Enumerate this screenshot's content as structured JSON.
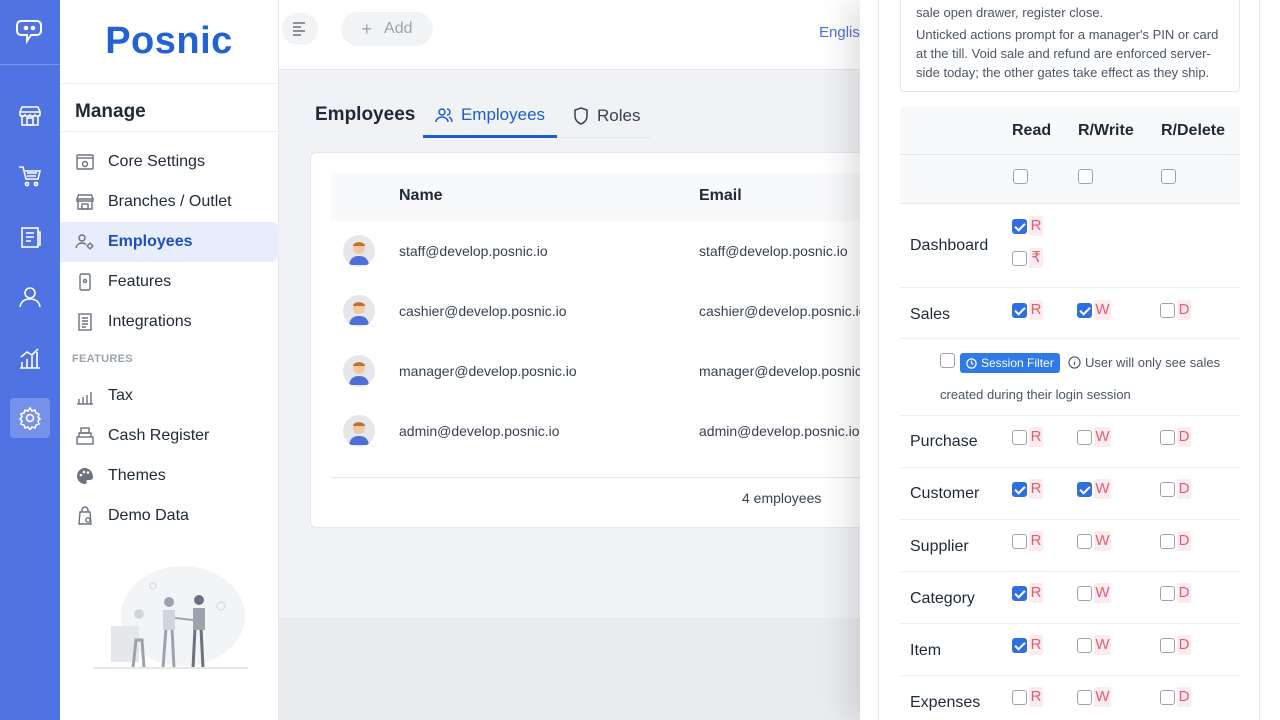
{
  "app": {
    "brand": "Posnic"
  },
  "rail": {
    "icons": [
      "logo-icon",
      "store-icon",
      "cart-icon",
      "clipboard-icon",
      "user-icon",
      "chart-icon",
      "settings-icon"
    ]
  },
  "sidebar": {
    "section_title": "Manage",
    "items": [
      {
        "label": "Core Settings",
        "icon": "settings-gear-icon"
      },
      {
        "label": "Branches / Outlet",
        "icon": "store-icon"
      },
      {
        "label": "Employees",
        "icon": "users-gear-icon",
        "active": true
      },
      {
        "label": "Features",
        "icon": "phone-icon"
      },
      {
        "label": "Integrations",
        "icon": "document-icon"
      }
    ],
    "features_header": "FEATURES",
    "feature_items": [
      {
        "label": "Tax",
        "icon": "chart-icon"
      },
      {
        "label": "Cash Register",
        "icon": "register-icon"
      },
      {
        "label": "Themes",
        "icon": "palette-icon"
      },
      {
        "label": "Demo Data",
        "icon": "data-icon"
      }
    ]
  },
  "topbar": {
    "add_label": "Add",
    "language": "English"
  },
  "main": {
    "page_title": "Employees",
    "tabs": [
      {
        "label": "Employees",
        "active": true
      },
      {
        "label": "Roles"
      }
    ],
    "table": {
      "columns": [
        "Name",
        "Email"
      ],
      "rows": [
        {
          "name": "staff@develop.posnic.io",
          "email": "staff@develop.posnic.io"
        },
        {
          "name": "cashier@develop.posnic.io",
          "email": "cashier@develop.posnic.io"
        },
        {
          "name": "manager@develop.posnic.io",
          "email": "manager@develop.posnic.io"
        },
        {
          "name": "admin@develop.posnic.io",
          "email": "admin@develop.posnic.io"
        }
      ],
      "footer": "4 employees"
    }
  },
  "drawer": {
    "info_line1": "sale open drawer, register close.",
    "info_line2": "Unticked actions prompt for a manager's PIN or card at the till. Void sale and refund are enforced server-side today; the other gates take effect as they ship.",
    "columns": [
      "Read",
      "R/Write",
      "R/Delete"
    ],
    "permissions": [
      {
        "name": "Dashboard",
        "read": true,
        "extra": false
      },
      {
        "name": "Sales",
        "read": true,
        "write": true,
        "delete": false
      },
      {
        "name": "Purchase",
        "read": false,
        "write": false,
        "delete": false
      },
      {
        "name": "Customer",
        "read": true,
        "write": true,
        "delete": false
      },
      {
        "name": "Supplier",
        "read": false,
        "write": false,
        "delete": false
      },
      {
        "name": "Category",
        "read": true,
        "write": false,
        "delete": false
      },
      {
        "name": "Item",
        "read": true,
        "write": false,
        "delete": false
      },
      {
        "name": "Expenses",
        "read": false,
        "write": false,
        "delete": false
      }
    ],
    "labels": {
      "read": "R",
      "write": "W",
      "delete": "D",
      "rupee": "₹"
    },
    "session_filter": {
      "tag": "Session Filter",
      "note": "User will only see sales",
      "note2": "created during their login session"
    }
  }
}
